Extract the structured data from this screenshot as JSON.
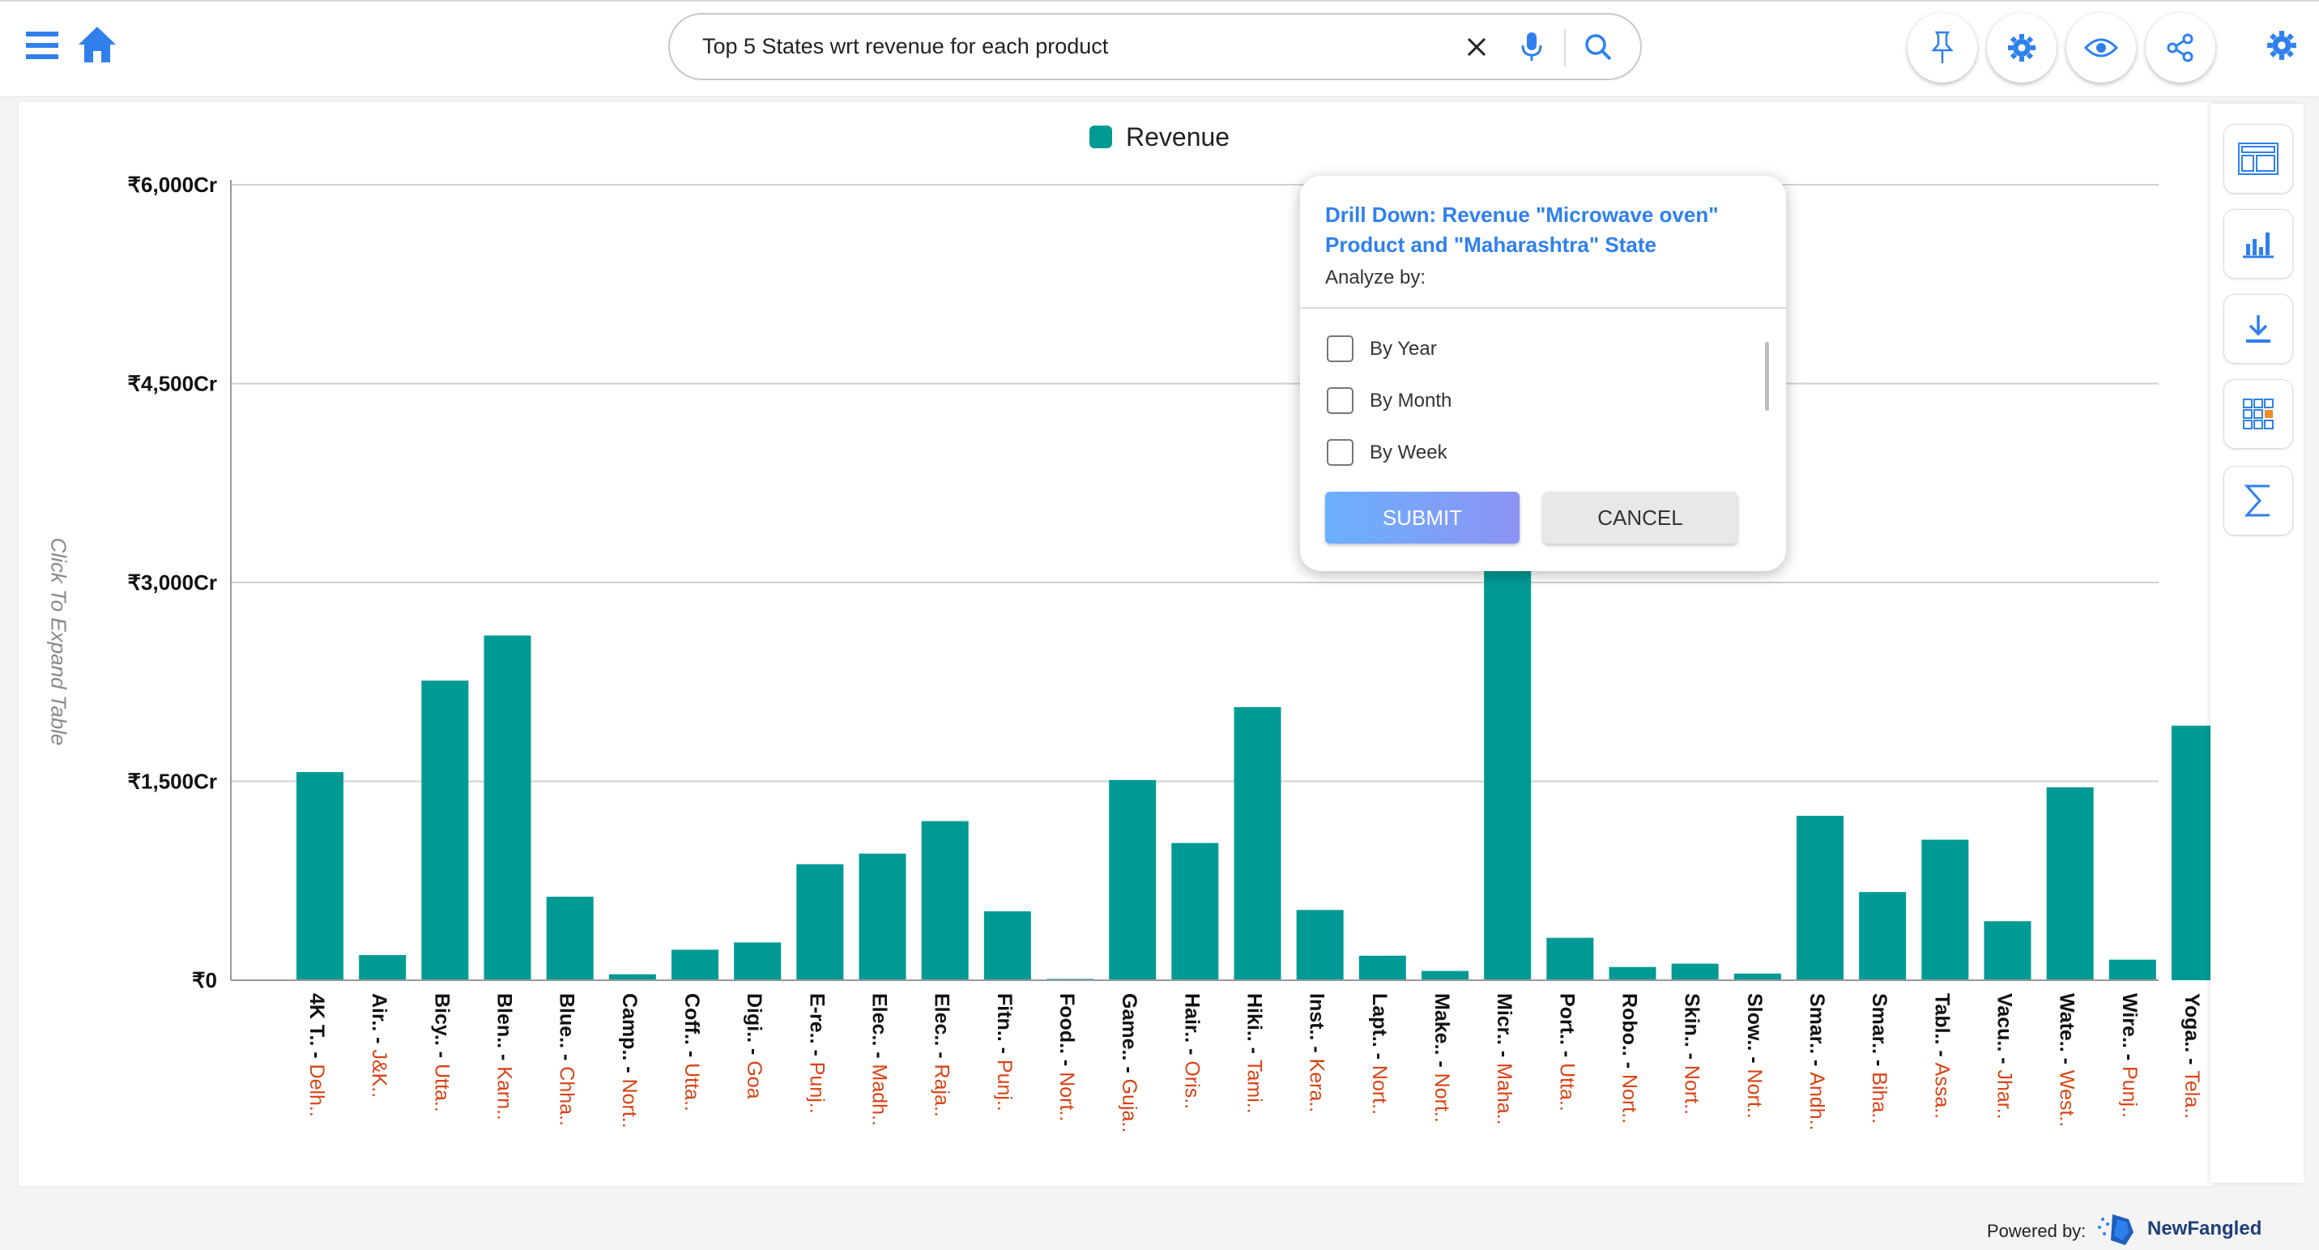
{
  "header": {
    "search_query": "Top 5 States wrt revenue  for each product",
    "icons": [
      "menu-icon",
      "home-icon",
      "clear-icon",
      "mic-icon",
      "search-icon",
      "pin-icon",
      "settings-icon",
      "eye-icon",
      "share-icon",
      "gear-icon"
    ]
  },
  "expand_table_label": "Click To Expand Table",
  "colors": {
    "accent": "#2f80ed",
    "bar": "#009a95",
    "state_label": "#d84315",
    "home_icon": "#2f80ed"
  },
  "chart_data": {
    "type": "bar",
    "legend": "Revenue",
    "legend_position": "top-center",
    "y_ticks": [
      "₹6,000Cr",
      "₹4,500Cr",
      "₹3,000Cr",
      "₹1,500Cr",
      "₹0"
    ],
    "ylim": [
      0,
      6000
    ],
    "grid": true,
    "categories": [
      {
        "product": "4K T..",
        "state": "Delh.."
      },
      {
        "product": "Air..",
        "state": "J&K.."
      },
      {
        "product": "Bicy..",
        "state": "Utta.."
      },
      {
        "product": "Blen..",
        "state": "Karn.."
      },
      {
        "product": "Blue..",
        "state": "Chha.."
      },
      {
        "product": "Camp..",
        "state": "Nort.."
      },
      {
        "product": "Coff..",
        "state": "Utta.."
      },
      {
        "product": "Digi..",
        "state": "Goa"
      },
      {
        "product": "E-re..",
        "state": "Punj.."
      },
      {
        "product": "Elec..",
        "state": "Madh.."
      },
      {
        "product": "Elec..",
        "state": "Raja.."
      },
      {
        "product": "Fitn..",
        "state": "Punj.."
      },
      {
        "product": "Food..",
        "state": "Nort.."
      },
      {
        "product": "Game..",
        "state": "Guja.."
      },
      {
        "product": "Hair..",
        "state": "Oris.."
      },
      {
        "product": "Hiki..",
        "state": "Tami.."
      },
      {
        "product": "Inst..",
        "state": "Kera.."
      },
      {
        "product": "Lapt..",
        "state": "Nort.."
      },
      {
        "product": "Make..",
        "state": "Nort.."
      },
      {
        "product": "Micr..",
        "state": "Maha.."
      },
      {
        "product": "Port..",
        "state": "Utta.."
      },
      {
        "product": "Robo..",
        "state": "Nort.."
      },
      {
        "product": "Skin..",
        "state": "Nort.."
      },
      {
        "product": "Slow..",
        "state": "Nort.."
      },
      {
        "product": "Smar..",
        "state": "Andh.."
      },
      {
        "product": "Smar..",
        "state": "Biha.."
      },
      {
        "product": "Tabl..",
        "state": "Assa.."
      },
      {
        "product": "Vacu..",
        "state": "Jhar.."
      },
      {
        "product": "Wate..",
        "state": "West.."
      },
      {
        "product": "Wire..",
        "state": "Punj.."
      },
      {
        "product": "Yoga..",
        "state": "Tela.."
      }
    ],
    "values": [
      1570,
      190,
      2260,
      2600,
      630,
      45,
      230,
      285,
      875,
      955,
      1200,
      520,
      10,
      1510,
      1035,
      2060,
      530,
      185,
      70,
      3330,
      320,
      100,
      125,
      50,
      1240,
      665,
      1060,
      445,
      1455,
      155,
      1920
    ]
  },
  "drilldown": {
    "title": "Drill Down: Revenue \"Microwave oven\" Product and \"Maharashtra\" State",
    "subtitle": "Analyze by:",
    "options": [
      "By Year",
      "By Month",
      "By Week"
    ],
    "submit_label": "SUBMIT",
    "cancel_label": "CANCEL"
  },
  "footer": {
    "powered_by": "Powered by:",
    "brand": "NewFangled"
  }
}
